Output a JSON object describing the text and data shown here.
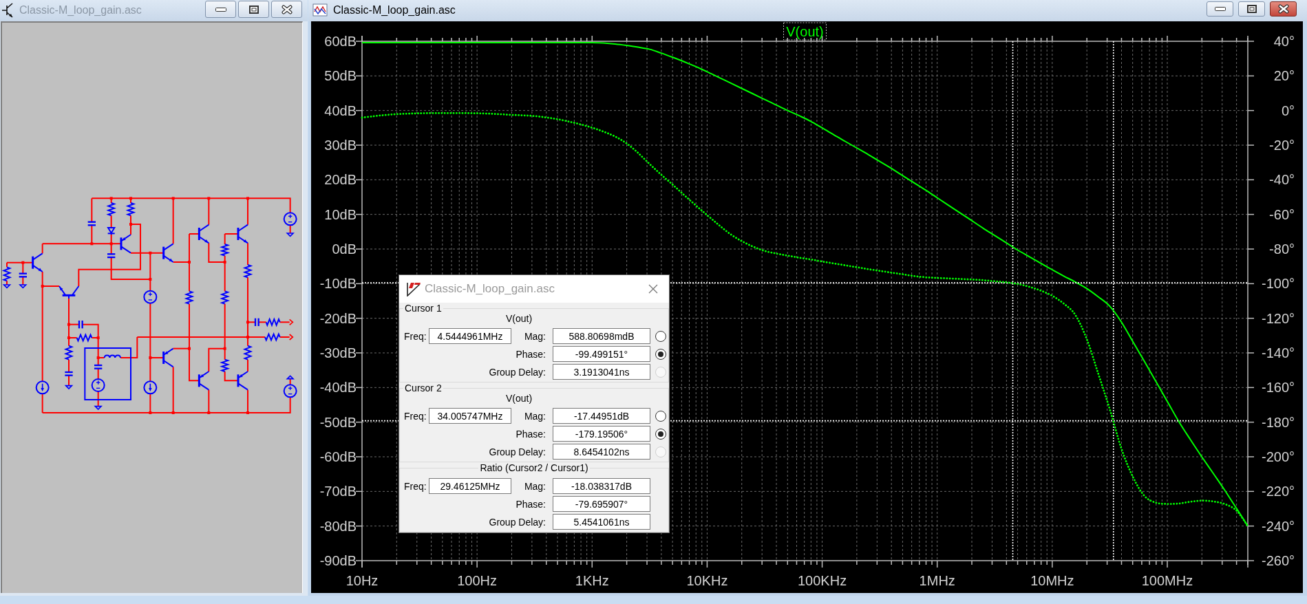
{
  "schematic_window": {
    "title": "Classic-M_loop_gain.asc",
    "active": false
  },
  "waveform_window": {
    "title": "Classic-M_loop_gain.asc",
    "active": true,
    "plots": [
      {
        "kind": "magnitude",
        "chart_data": {
          "type": "line",
          "title": "V(out)",
          "grid": true,
          "categories": [
            "10Hz",
            null,
            null,
            null,
            null,
            null,
            null,
            null,
            null,
            null,
            "100Hz",
            null,
            null,
            null,
            null,
            null,
            null,
            null,
            null,
            null,
            "1KHz",
            null,
            null,
            null,
            null,
            null,
            null,
            null,
            null,
            null,
            "10KHz",
            null,
            null,
            null,
            null,
            null,
            null,
            null,
            null,
            null,
            "100KHz",
            null,
            null,
            null,
            null,
            null,
            null,
            null,
            null,
            null,
            "1MHz",
            null,
            null,
            null,
            null,
            null,
            null,
            null,
            null,
            null,
            "10MHz",
            null,
            null,
            null,
            null,
            null,
            null,
            null,
            null,
            null,
            "100MHz",
            null,
            null,
            null,
            null,
            null,
            null,
            null
          ],
          "ylim": [
            -90,
            60
          ],
          "yticks": [
            {
              "value": 60,
              "label": "60dB"
            },
            {
              "value": 50,
              "label": "50dB"
            },
            {
              "value": 40,
              "label": "40dB"
            },
            {
              "value": 30,
              "label": "30dB"
            },
            {
              "value": 20,
              "label": "20dB"
            },
            {
              "value": 10,
              "label": "10dB"
            },
            {
              "value": 0,
              "label": "0dB"
            },
            {
              "value": -10,
              "label": "-10dB"
            },
            {
              "value": -20,
              "label": "-20dB"
            },
            {
              "value": -30,
              "label": "-30dB"
            },
            {
              "value": -40,
              "label": "-40dB"
            },
            {
              "value": -50,
              "label": "-50dB"
            },
            {
              "value": -60,
              "label": "-60dB"
            },
            {
              "value": -70,
              "label": "-70dB"
            },
            {
              "value": -80,
              "label": "-80dB"
            },
            {
              "value": -90,
              "label": "-90dB"
            }
          ],
          "series": [
            {
              "color": "#00ff00",
              "line_style": "solid",
              "values": [
                59.6,
                59.6,
                59.6,
                59.6,
                59.6,
                59.6,
                59.6,
                59.6,
                59.6,
                59.6,
                59.6,
                59.6,
                59.6,
                59.6,
                59.6,
                59.6,
                59.6,
                59.6,
                59.6,
                59.6,
                59.6,
                59.5,
                59.2,
                58.8,
                58.3,
                57.7,
                56.6,
                55.4,
                54.1,
                52.7,
                51.2,
                49.6,
                48.0,
                46.4,
                44.8,
                43.2,
                41.6,
                40.0,
                38.5,
                36.9,
                35.0,
                33.0,
                31.1,
                29.2,
                27.3,
                25.3,
                23.3,
                21.2,
                19.1,
                17.0,
                14.8,
                12.6,
                10.4,
                8.2,
                6.0,
                3.9,
                1.8,
                -0.3,
                -2.2,
                -4.1,
                -6.0,
                -7.8,
                -9.5,
                -11.4,
                -13.8,
                -16.5,
                -21.0,
                -26.7,
                -32.4,
                -38.2,
                -44.0,
                -49.8,
                -55.0,
                -60.0,
                -64.8,
                -69.7,
                -74.8,
                -80.0
              ]
            }
          ]
        }
      },
      {
        "kind": "phase",
        "chart_data": {
          "type": "line",
          "categories": [
            null,
            null,
            null,
            null,
            null,
            null,
            null,
            null,
            null,
            null,
            null,
            null,
            null,
            null,
            null,
            null,
            null,
            null,
            null,
            null,
            null,
            null,
            null,
            null,
            null,
            null,
            null,
            null,
            null,
            null,
            null,
            null,
            null,
            null,
            null,
            null,
            null,
            null,
            null,
            null,
            null,
            null,
            null,
            null,
            null,
            null,
            null,
            null,
            null,
            null,
            null,
            null,
            null,
            null,
            null,
            null,
            null,
            null,
            null,
            null,
            null,
            null,
            null,
            null,
            null,
            null,
            null,
            null,
            null,
            null,
            null,
            null,
            null,
            null,
            null,
            null,
            null,
            null
          ],
          "ylim": [
            -260,
            40
          ],
          "yticks": [
            {
              "value": 40,
              "label": "40°"
            },
            {
              "value": 20,
              "label": "20°"
            },
            {
              "value": 0,
              "label": "0°"
            },
            {
              "value": -20,
              "label": "-20°"
            },
            {
              "value": -40,
              "label": "-40°"
            },
            {
              "value": -60,
              "label": "-60°"
            },
            {
              "value": -80,
              "label": "-80°"
            },
            {
              "value": -100,
              "label": "-100°"
            },
            {
              "value": -120,
              "label": "-120°"
            },
            {
              "value": -140,
              "label": "-140°"
            },
            {
              "value": -160,
              "label": "-160°"
            },
            {
              "value": -180,
              "label": "-180°"
            },
            {
              "value": -200,
              "label": "-200°"
            },
            {
              "value": -220,
              "label": "-220°"
            },
            {
              "value": -240,
              "label": "-240°"
            },
            {
              "value": -260,
              "label": "-260°"
            }
          ],
          "series": [
            {
              "color": "#00ff00",
              "line_style": "dotted",
              "values": [
                -4.1,
                -3.3,
                -2.6,
                -2.1,
                -1.8,
                -1.6,
                -1.5,
                -1.5,
                -1.5,
                -1.5,
                -1.6,
                -1.8,
                -2.1,
                -2.5,
                -2.8,
                -3.2,
                -4.0,
                -5.0,
                -6.4,
                -8.0,
                -9.9,
                -12.2,
                -15.0,
                -19.0,
                -24.5,
                -30.9,
                -37.0,
                -42.8,
                -48.8,
                -54.7,
                -60.4,
                -66.0,
                -71.3,
                -75.4,
                -78.6,
                -81.1,
                -82.6,
                -83.8,
                -85.0,
                -86.0,
                -87.2,
                -88.3,
                -89.4,
                -90.5,
                -91.6,
                -92.6,
                -93.6,
                -94.6,
                -95.6,
                -96.3,
                -96.7,
                -97.0,
                -97.3,
                -97.6,
                -98.0,
                -98.6,
                -99.2,
                -100.2,
                -101.8,
                -104.0,
                -107.0,
                -111.5,
                -118.0,
                -132.0,
                -152.0,
                -172.5,
                -195.0,
                -211.5,
                -222.5,
                -226.5,
                -227.2,
                -227.0,
                -226.0,
                -225.3,
                -225.8,
                -227.3,
                -231.0,
                -240.0
              ]
            }
          ],
          "ref_lines": [
            {
              "axis": "y",
              "value": -99.5
            },
            {
              "axis": "y",
              "value": -179.2
            }
          ]
        }
      }
    ]
  },
  "cursor_dialog": {
    "title": "Classic-M_loop_gain.asc",
    "active": false,
    "groups": [
      {
        "kind": "cursor",
        "label": "Cursor 1",
        "trace": "V(out)",
        "freq": {
          "label": "Freq:",
          "value": "4.5444961MHz"
        },
        "fields": [
          {
            "label": "Mag:",
            "value": "588.80698mdB",
            "selected": false,
            "disabled": false
          },
          {
            "label": "Phase:",
            "value": "-99.499151°",
            "selected": true,
            "disabled": false
          },
          {
            "label": "Group Delay:",
            "value": "3.1913041ns",
            "selected": false,
            "disabled": true
          }
        ]
      },
      {
        "kind": "cursor",
        "label": "Cursor 2",
        "trace": "V(out)",
        "freq": {
          "label": "Freq:",
          "value": "34.005747MHz"
        },
        "fields": [
          {
            "label": "Mag:",
            "value": "-17.44951dB",
            "selected": false,
            "disabled": false
          },
          {
            "label": "Phase:",
            "value": "-179.19506°",
            "selected": true,
            "disabled": false
          },
          {
            "label": "Group Delay:",
            "value": "8.6454102ns",
            "selected": false,
            "disabled": true
          }
        ]
      },
      {
        "kind": "ratio",
        "label": "Ratio (Cursor2 / Cursor1)",
        "freq": {
          "label": "Freq:",
          "value": "29.46125MHz"
        },
        "fields": [
          {
            "label": "Mag:",
            "value": "-18.038317dB"
          },
          {
            "label": "Phase:",
            "value": "-79.695907°"
          },
          {
            "label": "Group Delay:",
            "value": "5.4541061ns"
          }
        ]
      }
    ]
  }
}
